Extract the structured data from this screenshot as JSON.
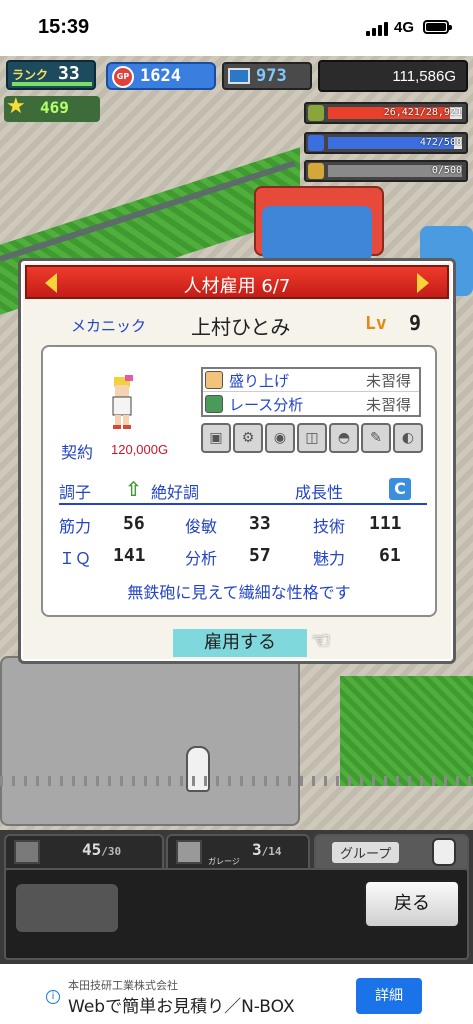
{
  "status_bar": {
    "time": "15:39",
    "network": "4G"
  },
  "hud": {
    "rank_label": "ランク",
    "rank_value": "33",
    "gp_icon_text": "GP",
    "gp_value": "1624",
    "pc_value": "973",
    "money": "111,586G",
    "stars": "469",
    "resources": [
      {
        "icon": "fuel-icon",
        "text": "26,421/28,921",
        "fill": 0.91,
        "color": "#e8402a"
      },
      {
        "icon": "oil-icon",
        "text": "472/500",
        "fill": 0.94,
        "color": "#3b6fe0"
      },
      {
        "icon": "wheat-icon",
        "text": "0/500",
        "fill": 0.0,
        "color": "#999999"
      }
    ]
  },
  "dialog": {
    "title": "人材雇用 6/7",
    "job": "メカニック",
    "name": "上村ひとみ",
    "lv_label": "Lv",
    "lv_value": "9",
    "contract_label": "契約",
    "contract_value": "120,000G",
    "skills": [
      {
        "name": "盛り上げ",
        "state": "未習得"
      },
      {
        "name": "レース分析",
        "state": "未習得"
      }
    ],
    "condition_label": "調子",
    "condition_value": "絶好調",
    "growth_label": "成長性",
    "growth_value": "C",
    "stats": [
      {
        "label": "筋力",
        "value": "56"
      },
      {
        "label": "俊敏",
        "value": "33"
      },
      {
        "label": "技術",
        "value": "111"
      },
      {
        "label": "ＩＱ",
        "value": "141"
      },
      {
        "label": "分析",
        "value": "57"
      },
      {
        "label": "魅力",
        "value": "61"
      }
    ],
    "description": "無鉄砲に見えて繊細な性格です",
    "hire_button": "雇用する"
  },
  "bottom": {
    "tab1_value": "45",
    "tab1_max": "/30",
    "tab2_value": "3",
    "tab2_max": "/14",
    "tab2_icon_label": "ガレージ",
    "group_label": "グループ",
    "back_button": "戻る"
  },
  "ad": {
    "company": "本田技研工業株式会社",
    "headline": "Webで簡単お見積り／N-BOX",
    "cta": "詳細"
  }
}
